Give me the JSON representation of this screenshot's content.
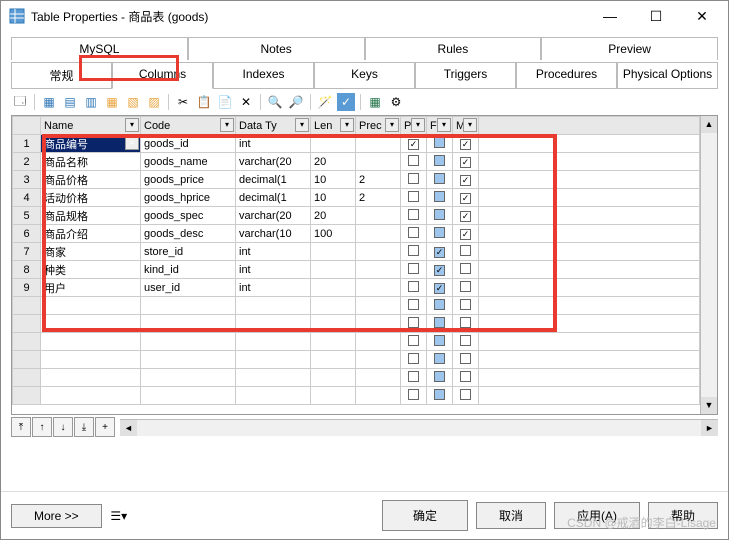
{
  "window": {
    "title": "Table Properties - 商品表 (goods)"
  },
  "tabs_top": [
    {
      "label": "MySQL"
    },
    {
      "label": "Notes"
    },
    {
      "label": "Rules"
    },
    {
      "label": "Preview"
    }
  ],
  "tabs_bottom": [
    {
      "label": "常规"
    },
    {
      "label": "Columns",
      "active": true
    },
    {
      "label": "Indexes"
    },
    {
      "label": "Keys"
    },
    {
      "label": "Triggers"
    },
    {
      "label": "Procedures"
    },
    {
      "label": "Physical Options"
    }
  ],
  "grid": {
    "headers": [
      "",
      "Name",
      "Code",
      "Data Ty",
      "Len",
      "Prec",
      "P",
      "F",
      "M"
    ],
    "rows": [
      {
        "n": "1",
        "name": "商品编号",
        "code": "goods_id",
        "type": "int",
        "len": "",
        "prec": "",
        "p": true,
        "f": false,
        "m": true,
        "sel": true
      },
      {
        "n": "2",
        "name": "商品名称",
        "code": "goods_name",
        "type": "varchar(20",
        "len": "20",
        "prec": "",
        "p": false,
        "f": false,
        "m": true
      },
      {
        "n": "3",
        "name": "商品价格",
        "code": "goods_price",
        "type": "decimal(1",
        "len": "10",
        "prec": "2",
        "p": false,
        "f": false,
        "m": true
      },
      {
        "n": "4",
        "name": "活动价格",
        "code": "goods_hprice",
        "type": "decimal(1",
        "len": "10",
        "prec": "2",
        "p": false,
        "f": false,
        "m": true
      },
      {
        "n": "5",
        "name": "商品规格",
        "code": "goods_spec",
        "type": "varchar(20",
        "len": "20",
        "prec": "",
        "p": false,
        "f": false,
        "m": true
      },
      {
        "n": "6",
        "name": "商品介绍",
        "code": "goods_desc",
        "type": "varchar(10",
        "len": "100",
        "prec": "",
        "p": false,
        "f": false,
        "m": true
      },
      {
        "n": "7",
        "name": "商家",
        "code": "store_id",
        "type": "int",
        "len": "",
        "prec": "",
        "p": false,
        "f": true,
        "m": false
      },
      {
        "n": "8",
        "name": "种类",
        "code": "kind_id",
        "type": "int",
        "len": "",
        "prec": "",
        "p": false,
        "f": true,
        "m": false
      },
      {
        "n": "9",
        "name": "用户",
        "code": "user_id",
        "type": "int",
        "len": "",
        "prec": "",
        "p": false,
        "f": true,
        "m": false
      }
    ],
    "empty_rows": 6
  },
  "footer": {
    "more": "More >>",
    "ok": "确定",
    "cancel": "取消",
    "apply": "应用(A)",
    "help": "帮助"
  },
  "watermark": "CSDN @戒酒的李白-Lisage"
}
